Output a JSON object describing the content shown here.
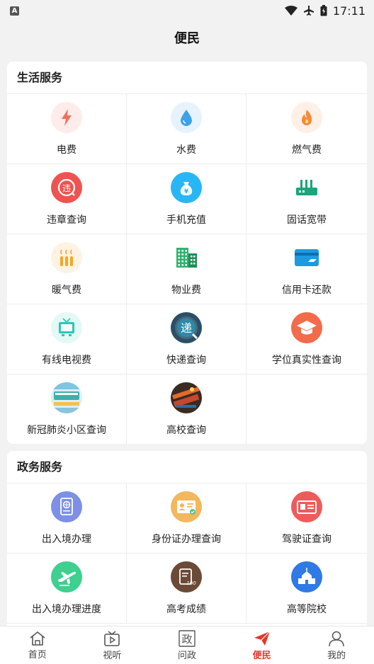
{
  "status": {
    "time": "17:11",
    "notification_letter": "A"
  },
  "header": {
    "title": "便民"
  },
  "sections": [
    {
      "title": "生活服务",
      "items": [
        {
          "label": "电费",
          "icon": "lightning-icon",
          "color": "#f07060"
        },
        {
          "label": "水费",
          "icon": "water-drop-icon",
          "color": "#3ea2e8"
        },
        {
          "label": "燃气费",
          "icon": "flame-icon",
          "color": "#f7893a"
        },
        {
          "label": "违章查询",
          "icon": "traffic-violation-icon",
          "color": "#ef5350"
        },
        {
          "label": "手机充值",
          "icon": "money-bag-icon",
          "color": "#29b6f6"
        },
        {
          "label": "固话宽带",
          "icon": "router-icon",
          "color": "#1aa57a"
        },
        {
          "label": "暖气费",
          "icon": "heater-icon",
          "color": "#f6a623"
        },
        {
          "label": "物业费",
          "icon": "building-icon",
          "color": "#2fb36f"
        },
        {
          "label": "信用卡还款",
          "icon": "credit-card-icon",
          "color": "#1e9ae0"
        },
        {
          "label": "有线电视费",
          "icon": "tv-icon",
          "color": "#2cc7b5"
        },
        {
          "label": "快递查询",
          "icon": "express-icon",
          "color": "#2d89a8",
          "glyph": "递"
        },
        {
          "label": "学位真实性查询",
          "icon": "graduation-cap-icon",
          "color": "#f26b4a"
        },
        {
          "label": "新冠肺炎小区查询",
          "icon": "community-icon",
          "color": "#7fc4e0"
        },
        {
          "label": "高校查询",
          "icon": "campus-photo-icon",
          "color": "#3a2a22"
        }
      ]
    },
    {
      "title": "政务服务",
      "items": [
        {
          "label": "出入境办理",
          "icon": "passport-icon",
          "color": "#7d8fe6"
        },
        {
          "label": "身份证办理查询",
          "icon": "id-card-icon",
          "color": "#f3b75d"
        },
        {
          "label": "驾驶证查询",
          "icon": "driver-license-icon",
          "color": "#ef5b5b"
        },
        {
          "label": "出入境办理进度",
          "icon": "airplane-icon",
          "color": "#3fcf8e"
        },
        {
          "label": "高考成绩",
          "icon": "score-sheet-icon",
          "color": "#6b4a36",
          "glyph": "100"
        },
        {
          "label": "高等院校",
          "icon": "school-icon",
          "color": "#2f7ae5"
        }
      ]
    }
  ],
  "tabs": [
    {
      "label": "首页",
      "icon": "home-icon"
    },
    {
      "label": "视听",
      "icon": "tv-play-icon"
    },
    {
      "label": "问政",
      "icon": "politics-icon",
      "glyph": "政"
    },
    {
      "label": "便民",
      "icon": "paper-plane-icon",
      "active": true,
      "color": "#e8352a"
    },
    {
      "label": "我的",
      "icon": "person-icon"
    }
  ]
}
